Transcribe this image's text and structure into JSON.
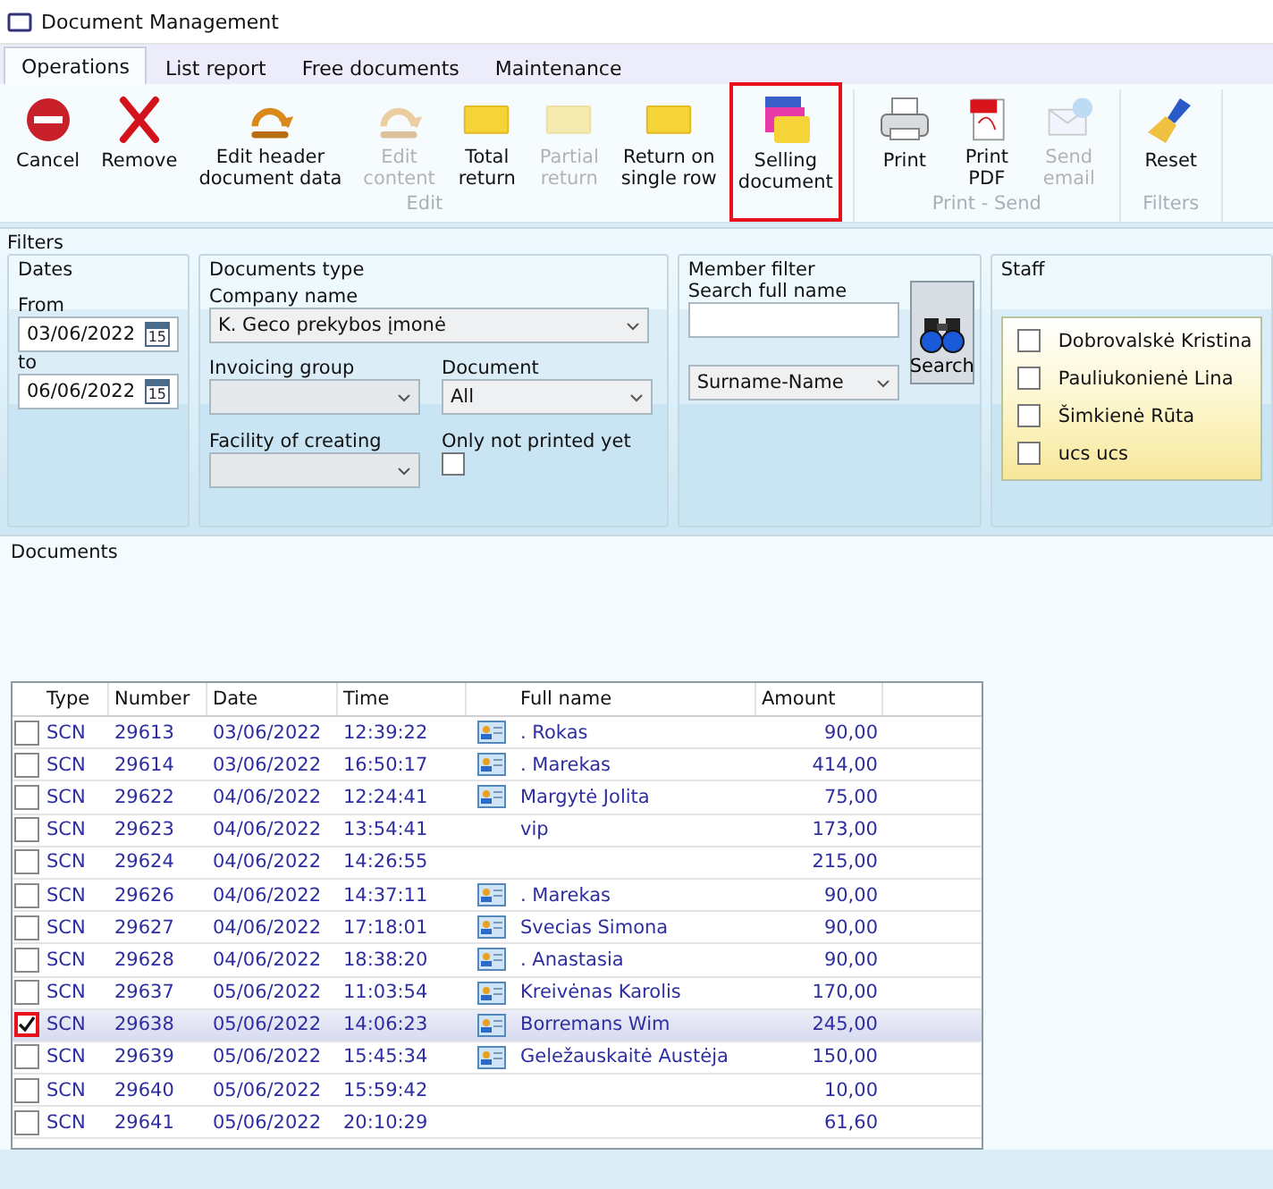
{
  "window": {
    "title": "Document Management"
  },
  "tabs": [
    {
      "label": "Operations",
      "selected": true
    },
    {
      "label": "List report",
      "selected": false
    },
    {
      "label": "Free documents",
      "selected": false
    },
    {
      "label": "Maintenance",
      "selected": false
    }
  ],
  "ribbon": {
    "groups": [
      {
        "label": "Edit",
        "buttons": [
          {
            "kind": "cancel",
            "label": "Cancel",
            "disabled": false,
            "highlighted": false
          },
          {
            "kind": "remove",
            "label": "Remove",
            "disabled": false,
            "highlighted": false
          },
          {
            "kind": "undo",
            "label": "Edit header\ndocument data",
            "disabled": false,
            "highlighted": false
          },
          {
            "kind": "undo",
            "label": "Edit\ncontent",
            "disabled": true,
            "highlighted": false
          },
          {
            "kind": "folder",
            "label": "Total\nreturn",
            "disabled": false,
            "highlighted": false
          },
          {
            "kind": "folder",
            "label": "Partial\nreturn",
            "disabled": true,
            "highlighted": false
          },
          {
            "kind": "folder",
            "label": "Return on\nsingle row",
            "disabled": false,
            "highlighted": false
          },
          {
            "kind": "stack",
            "label": "Selling\ndocument",
            "disabled": false,
            "highlighted": true
          }
        ]
      },
      {
        "label": "Print - Send",
        "buttons": [
          {
            "kind": "printer",
            "label": "Print",
            "disabled": false,
            "highlighted": false
          },
          {
            "kind": "pdf",
            "label": "Print\nPDF",
            "disabled": false,
            "highlighted": false
          },
          {
            "kind": "mail",
            "label": "Send\nemail",
            "disabled": true,
            "highlighted": false
          }
        ]
      },
      {
        "label": "Filters",
        "buttons": [
          {
            "kind": "broom",
            "label": "Reset",
            "disabled": false,
            "highlighted": false
          }
        ]
      }
    ]
  },
  "filters": {
    "title": "Filters",
    "dates": {
      "title": "Dates",
      "fields": [
        {
          "label": "From",
          "value": "03/06/2022",
          "calendar": "15"
        },
        {
          "label": "to",
          "value": "06/06/2022",
          "calendar": "15"
        }
      ]
    },
    "documents_type": {
      "title": "Documents type",
      "company_label": "Company name",
      "company_value": "K. Geco prekybos įmonė",
      "invoicing_label": "Invoicing group",
      "document_label": "Document",
      "document_value": "All",
      "facility_label": "Facility of creating",
      "only_not_printed_label": "Only not printed yet",
      "only_not_printed_checked": false
    },
    "member_filter": {
      "title": "Member filter",
      "search_label": "Search full name",
      "order_value": "Surname-Name",
      "search_button": "Search"
    },
    "staff": {
      "title": "Staff",
      "items": [
        {
          "name": "Dobrovalskė Kristina",
          "checked": false
        },
        {
          "name": "Pauliukonienė Lina",
          "checked": false
        },
        {
          "name": "Šimkienė Rūta",
          "checked": false
        },
        {
          "name": "ucs ucs",
          "checked": false
        }
      ]
    }
  },
  "documents": {
    "title": "Documents",
    "columns": [
      "Type",
      "Number",
      "Date",
      "Time",
      "Full name",
      "Amount"
    ],
    "rows": [
      {
        "type": "SCN",
        "number": "29613",
        "date": "03/06/2022",
        "time": "12:39:22",
        "card": true,
        "full_name": ". Rokas",
        "amount": "90,00",
        "checked": false,
        "selected": false
      },
      {
        "type": "SCN",
        "number": "29614",
        "date": "03/06/2022",
        "time": "16:50:17",
        "card": true,
        "full_name": ". Marekas",
        "amount": "414,00",
        "checked": false,
        "selected": false
      },
      {
        "type": "SCN",
        "number": "29622",
        "date": "04/06/2022",
        "time": "12:24:41",
        "card": true,
        "full_name": "Margytė Jolita",
        "amount": "75,00",
        "checked": false,
        "selected": false
      },
      {
        "type": "SCN",
        "number": "29623",
        "date": "04/06/2022",
        "time": "13:54:41",
        "card": false,
        "full_name": "vip",
        "amount": "173,00",
        "checked": false,
        "selected": false
      },
      {
        "type": "SCN",
        "number": "29624",
        "date": "04/06/2022",
        "time": "14:26:55",
        "card": false,
        "amount": "215,00",
        "checked": false,
        "selected": false
      },
      {
        "type": "SCN",
        "number": "29626",
        "date": "04/06/2022",
        "time": "14:37:11",
        "card": true,
        "full_name": ". Marekas",
        "amount": "90,00",
        "checked": false,
        "selected": false
      },
      {
        "type": "SCN",
        "number": "29627",
        "date": "04/06/2022",
        "time": "17:18:01",
        "card": true,
        "full_name": "Svecias Simona",
        "amount": "90,00",
        "checked": false,
        "selected": false
      },
      {
        "type": "SCN",
        "number": "29628",
        "date": "04/06/2022",
        "time": "18:38:20",
        "card": true,
        "full_name": ". Anastasia",
        "amount": "90,00",
        "checked": false,
        "selected": false
      },
      {
        "type": "SCN",
        "number": "29637",
        "date": "05/06/2022",
        "time": "11:03:54",
        "card": true,
        "full_name": "Kreivėnas Karolis",
        "amount": "170,00",
        "checked": false,
        "selected": false
      },
      {
        "type": "SCN",
        "number": "29638",
        "date": "05/06/2022",
        "time": "14:06:23",
        "card": true,
        "full_name": "Borremans Wim",
        "amount": "245,00",
        "checked": true,
        "selected": true,
        "highlighted": true
      },
      {
        "type": "SCN",
        "number": "29639",
        "date": "05/06/2022",
        "time": "15:45:34",
        "card": true,
        "full_name": "Geležauskaitė Austėja",
        "amount": "150,00",
        "checked": false,
        "selected": false
      },
      {
        "type": "SCN",
        "number": "29640",
        "date": "05/06/2022",
        "time": "15:59:42",
        "card": false,
        "amount": "10,00",
        "checked": false,
        "selected": false
      },
      {
        "type": "SCN",
        "number": "29641",
        "date": "05/06/2022",
        "time": "20:10:29",
        "card": false,
        "amount": "61,60",
        "checked": false,
        "selected": false
      }
    ]
  }
}
